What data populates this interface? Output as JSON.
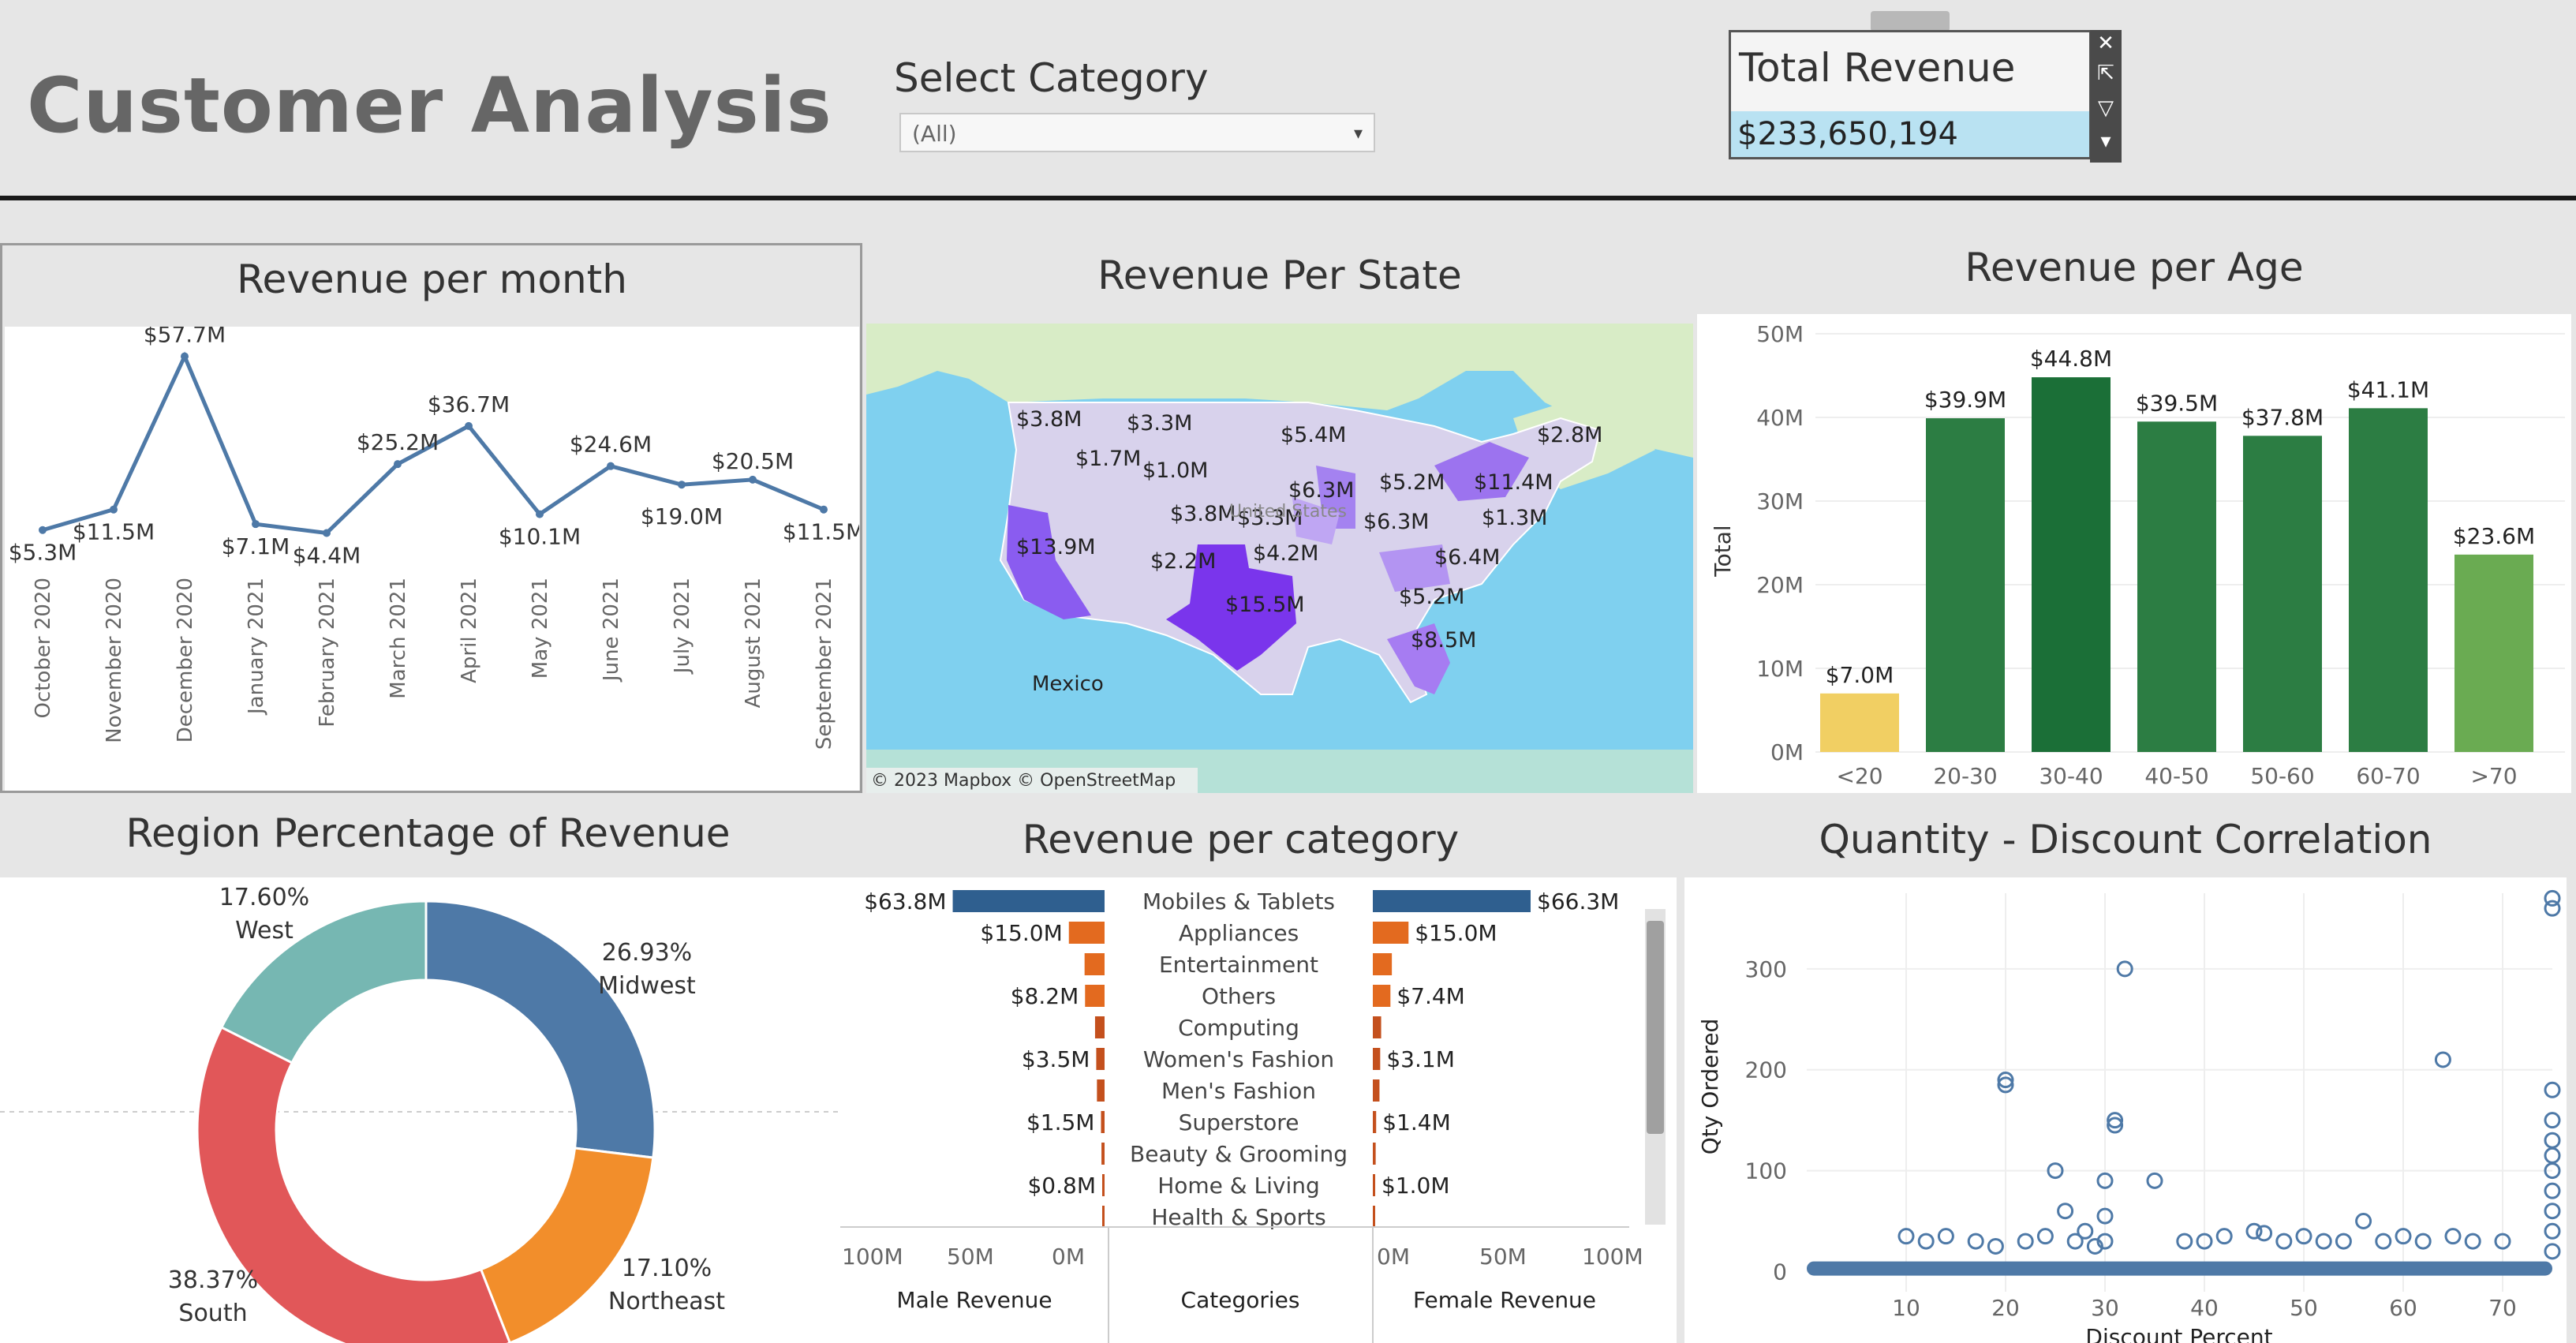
{
  "header": {
    "title": "Customer Analysis",
    "filter_label": "Select Category",
    "filter_value": "(All)",
    "kpi_label": "Total Revenue",
    "kpi_value": "$233,650,194"
  },
  "panels": {
    "revenue_month": {
      "title": "Revenue per month",
      "chart_data": {
        "type": "line",
        "title": "Revenue per month",
        "categories": [
          "October 2020",
          "November 2020",
          "December 2020",
          "January 2021",
          "February 2021",
          "March 2021",
          "April 2021",
          "May 2021",
          "June 2021",
          "July 2021",
          "August 2021",
          "September 2021"
        ],
        "values": [
          5.3,
          11.5,
          57.7,
          7.1,
          4.4,
          25.2,
          36.7,
          10.1,
          24.6,
          19.0,
          20.5,
          11.5
        ],
        "labels": [
          "$5.3M",
          "$11.5M",
          "$57.7M",
          "$7.1M",
          "$4.4M",
          "$25.2M",
          "$36.7M",
          "$10.1M",
          "$24.6M",
          "$19.0M",
          "$20.5M",
          "$11.5M"
        ],
        "color": "#4e79a7"
      }
    },
    "revenue_state": {
      "title": "Revenue Per State",
      "attribution": "© 2023 Mapbox © OpenStreetMap",
      "map_labels": [
        "$3.8M",
        "$3.3M",
        "$5.4M",
        "$2.8M",
        "$1.7M",
        "$1.0M",
        "$6.3M",
        "$5.2M",
        "$11.4M",
        "$13.9M",
        "$3.8M",
        "$3.3M",
        "$6.3M",
        "$1.3M",
        "$2.2M",
        "$4.2M",
        "$6.4M",
        "$15.5M",
        "$5.2M",
        "$8.5M"
      ],
      "country_labels": [
        "Mexico",
        "United States"
      ]
    },
    "revenue_age": {
      "title": "Revenue per Age",
      "chart_data": {
        "type": "bar",
        "title": "Revenue per Age",
        "ylabel": "Total",
        "categories": [
          "<20",
          "20-30",
          "30-40",
          "40-50",
          "50-60",
          "60-70",
          ">70"
        ],
        "values": [
          7.0,
          39.9,
          44.8,
          39.5,
          37.8,
          41.1,
          23.6
        ],
        "labels": [
          "$7.0M",
          "$39.9M",
          "$44.8M",
          "$39.5M",
          "$37.8M",
          "$41.1M",
          "$23.6M"
        ],
        "colors": [
          "#f1cf63",
          "#2c7d43",
          "#1b6f37",
          "#2c7d43",
          "#2c7d43",
          "#2c7d43",
          "#6aab52"
        ],
        "yticks": [
          "0M",
          "10M",
          "20M",
          "30M",
          "40M",
          "50M"
        ],
        "ylim": [
          0,
          50
        ]
      }
    },
    "region": {
      "title": "Region Percentage of Revenue",
      "chart_data": {
        "type": "pie",
        "title": "Region Percentage of Revenue",
        "categories": [
          "Midwest",
          "Northeast",
          "South",
          "West"
        ],
        "values": [
          26.93,
          17.1,
          38.37,
          17.6
        ],
        "labels": [
          "26.93%",
          "17.10%",
          "38.37%",
          "17.60%"
        ],
        "colors": [
          "#4e79a7",
          "#f28e2b",
          "#e15759",
          "#76b7b2"
        ]
      }
    },
    "category": {
      "title": "Revenue per category",
      "left_axis_label": "Male Revenue",
      "center_label": "Categories",
      "right_axis_label": "Female Revenue",
      "left_ticks": [
        "100M",
        "50M",
        "0M"
      ],
      "right_ticks": [
        "0M",
        "50M",
        "100M"
      ],
      "chart_data": {
        "type": "bar",
        "title": "Revenue per category",
        "categories": [
          "Mobiles & Tablets",
          "Appliances",
          "Entertainment",
          "Others",
          "Computing",
          "Women's Fashion",
          "Men's Fashion",
          "Superstore",
          "Beauty & Grooming",
          "Home & Living",
          "Health & Sports"
        ],
        "series": [
          {
            "name": "Male Revenue",
            "values": [
              63.8,
              15.0,
              8.4,
              8.2,
              4.0,
              3.5,
              3.2,
              1.5,
              1.3,
              0.8,
              0.7
            ],
            "labels": [
              "$63.8M",
              "$15.0M",
              "",
              "$8.2M",
              "",
              "$3.5M",
              "",
              "$1.5M",
              "",
              "$0.8M",
              ""
            ]
          },
          {
            "name": "Female Revenue",
            "values": [
              66.3,
              15.0,
              8.0,
              7.4,
              3.5,
              3.1,
              2.8,
              1.4,
              1.2,
              1.0,
              0.8
            ],
            "labels": [
              "$66.3M",
              "$15.0M",
              "",
              "$7.4M",
              "",
              "$3.1M",
              "",
              "$1.4M",
              "",
              "$1.0M",
              ""
            ]
          }
        ],
        "xlim": [
          0,
          100
        ],
        "colors": [
          "#2f5f8f",
          "#e36a1f",
          "#c4501d"
        ]
      }
    },
    "scatter": {
      "title": "Quantity - Discount Correlation",
      "chart_data": {
        "type": "scatter",
        "title": "Quantity - Discount Correlation",
        "xlabel": "Discount Percent",
        "ylabel": "Qty Ordered",
        "xticks": [
          "10",
          "20",
          "30",
          "40",
          "50",
          "60",
          "70"
        ],
        "yticks": [
          "0",
          "100",
          "200",
          "300"
        ],
        "xlim": [
          0,
          75
        ],
        "ylim": [
          -20,
          375
        ],
        "color": "#4e79a7",
        "points": [
          [
            10,
            35
          ],
          [
            12,
            30
          ],
          [
            14,
            35
          ],
          [
            17,
            30
          ],
          [
            19,
            25
          ],
          [
            20,
            190
          ],
          [
            20,
            185
          ],
          [
            22,
            30
          ],
          [
            24,
            35
          ],
          [
            25,
            100
          ],
          [
            26,
            60
          ],
          [
            27,
            30
          ],
          [
            28,
            40
          ],
          [
            29,
            25
          ],
          [
            30,
            90
          ],
          [
            30,
            55
          ],
          [
            30,
            30
          ],
          [
            31,
            150
          ],
          [
            31,
            145
          ],
          [
            32,
            300
          ],
          [
            35,
            90
          ],
          [
            38,
            30
          ],
          [
            40,
            30
          ],
          [
            42,
            35
          ],
          [
            45,
            40
          ],
          [
            46,
            38
          ],
          [
            48,
            30
          ],
          [
            50,
            35
          ],
          [
            52,
            30
          ],
          [
            54,
            30
          ],
          [
            56,
            50
          ],
          [
            58,
            30
          ],
          [
            60,
            35
          ],
          [
            62,
            30
          ],
          [
            64,
            210
          ],
          [
            65,
            35
          ],
          [
            67,
            30
          ],
          [
            70,
            30
          ],
          [
            75,
            370
          ],
          [
            75,
            360
          ],
          [
            75,
            180
          ],
          [
            75,
            150
          ],
          [
            75,
            130
          ],
          [
            75,
            115
          ],
          [
            75,
            100
          ],
          [
            75,
            80
          ],
          [
            75,
            60
          ],
          [
            75,
            40
          ],
          [
            75,
            20
          ]
        ]
      }
    }
  }
}
